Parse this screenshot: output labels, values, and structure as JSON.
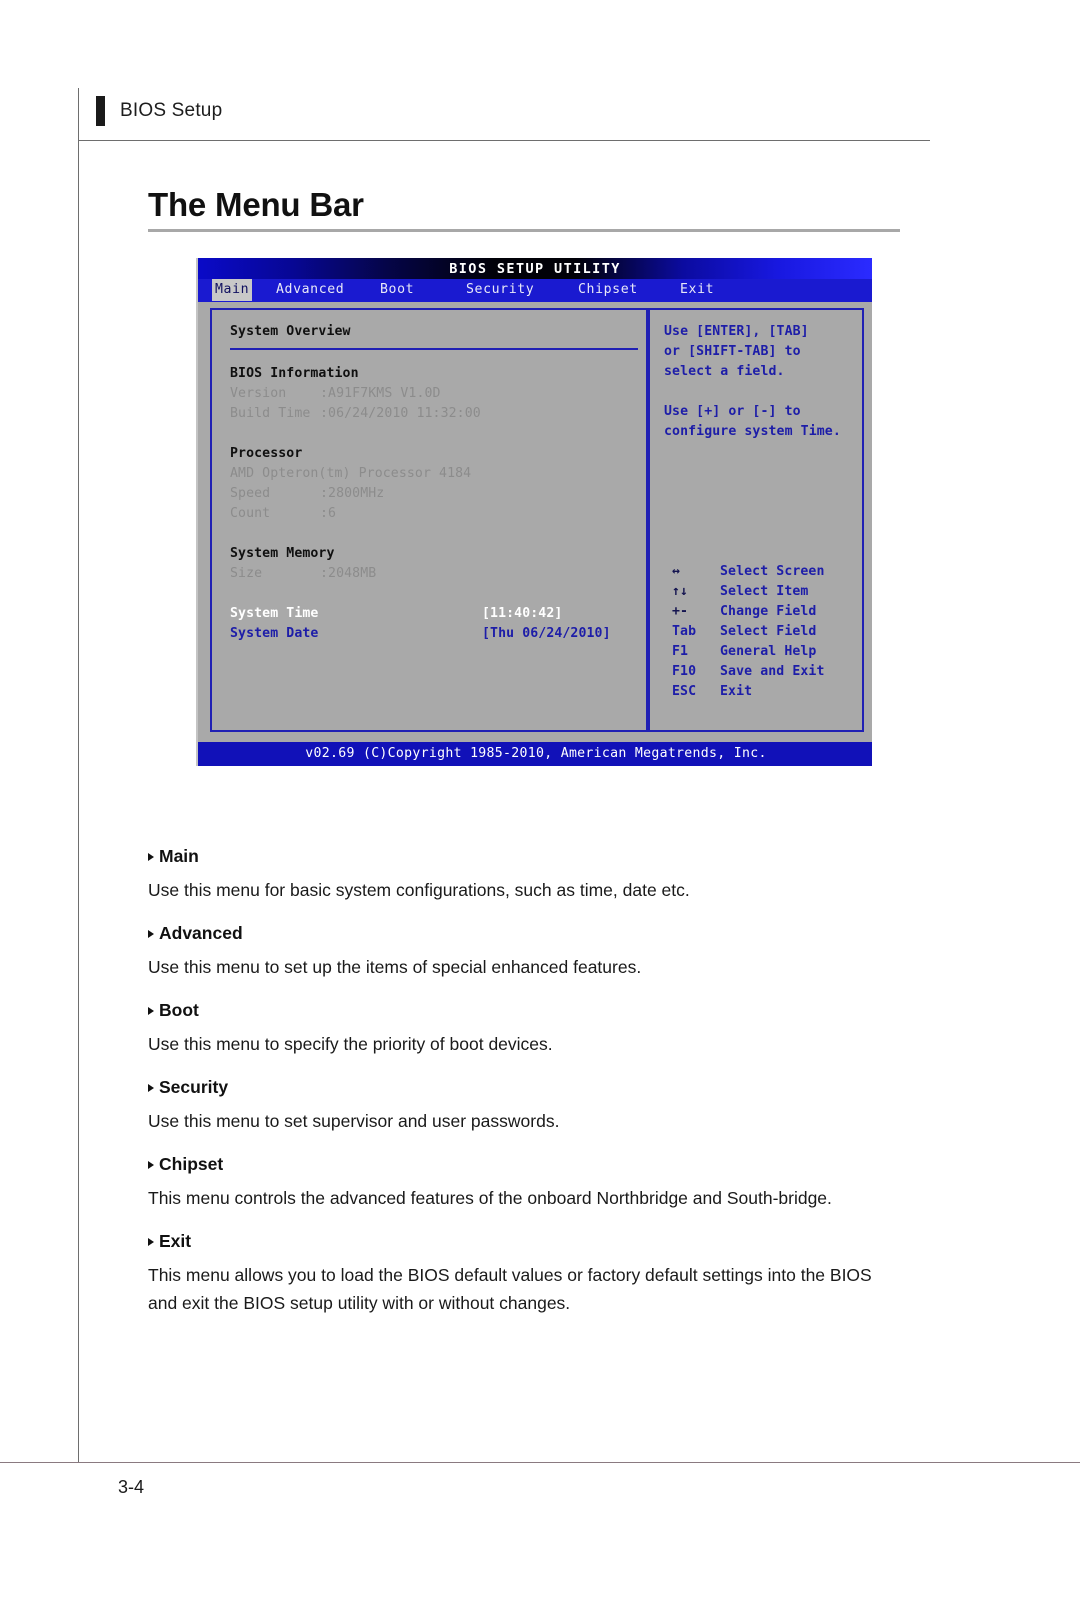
{
  "header": {
    "running_head": "BIOS Setup"
  },
  "section": {
    "title": "The Menu Bar"
  },
  "bios_screen": {
    "title": "BIOS SETUP UTILITY",
    "menu_items": [
      {
        "label": "Main",
        "selected": true
      },
      {
        "label": "Advanced",
        "selected": false
      },
      {
        "label": "Boot",
        "selected": false
      },
      {
        "label": "Security",
        "selected": false
      },
      {
        "label": "Chipset",
        "selected": false
      },
      {
        "label": "Exit",
        "selected": false
      }
    ],
    "left_panel": {
      "heading": "System Overview",
      "groups": [
        {
          "title": "BIOS Information",
          "rows": [
            {
              "label": "Version",
              "value": ":A91F7KMS V1.0D"
            },
            {
              "label": "Build Time",
              "value": ":06/24/2010 11:32:00"
            }
          ]
        },
        {
          "title": "Processor",
          "rows": [
            {
              "label": "AMD Opteron(tm) Processor 4184",
              "value": ""
            },
            {
              "label": "Speed",
              "value": ":2800MHz"
            },
            {
              "label": "Count",
              "value": ":6"
            }
          ]
        },
        {
          "title": "System Memory",
          "rows": [
            {
              "label": "Size",
              "value": ":2048MB"
            }
          ]
        }
      ],
      "fields": [
        {
          "label": "System Time",
          "value": "[11:40:42]",
          "selected": true
        },
        {
          "label": "System Date",
          "value": "[Thu 06/24/2010]",
          "selected": false
        }
      ]
    },
    "right_panel": {
      "help_paragraphs": [
        "Use [ENTER], [TAB]",
        "or [SHIFT-TAB] to",
        "select a field.",
        "Use [+] or [-] to",
        "configure system Time."
      ],
      "key_legend": [
        {
          "key": "↔",
          "action": "Select Screen"
        },
        {
          "key": "↑↓",
          "action": "Select Item"
        },
        {
          "key": "+-",
          "action": "Change Field"
        },
        {
          "key": "Tab",
          "action": "Select Field"
        },
        {
          "key": "F1",
          "action": "General Help"
        },
        {
          "key": "F10",
          "action": "Save and Exit"
        },
        {
          "key": "ESC",
          "action": "Exit"
        }
      ]
    },
    "footer": "v02.69 (C)Copyright 1985-2010, American Megatrends, Inc."
  },
  "descriptions": [
    {
      "term": "Main",
      "definition": "Use this menu for basic system configurations, such as time, date etc."
    },
    {
      "term": "Advanced",
      "definition": "Use this menu to set up the items of special enhanced features."
    },
    {
      "term": "Boot",
      "definition": "Use this menu to specify the priority of boot devices."
    },
    {
      "term": "Security",
      "definition": "Use this menu to set supervisor and user passwords."
    },
    {
      "term": "Chipset",
      "definition": "This menu controls the advanced features of the onboard Northbridge and South-bridge."
    },
    {
      "term": "Exit",
      "definition": "This menu allows you to load the BIOS default values or factory default settings into the BIOS and exit the BIOS setup utility with or without changes."
    }
  ],
  "page_number": "3-4",
  "colors": {
    "bios_blue": "#1a1ad0",
    "bios_gray": "#a9a9a9",
    "bios_text_blue": "#1d1da8",
    "bios_dim": "#8c8c8c"
  }
}
